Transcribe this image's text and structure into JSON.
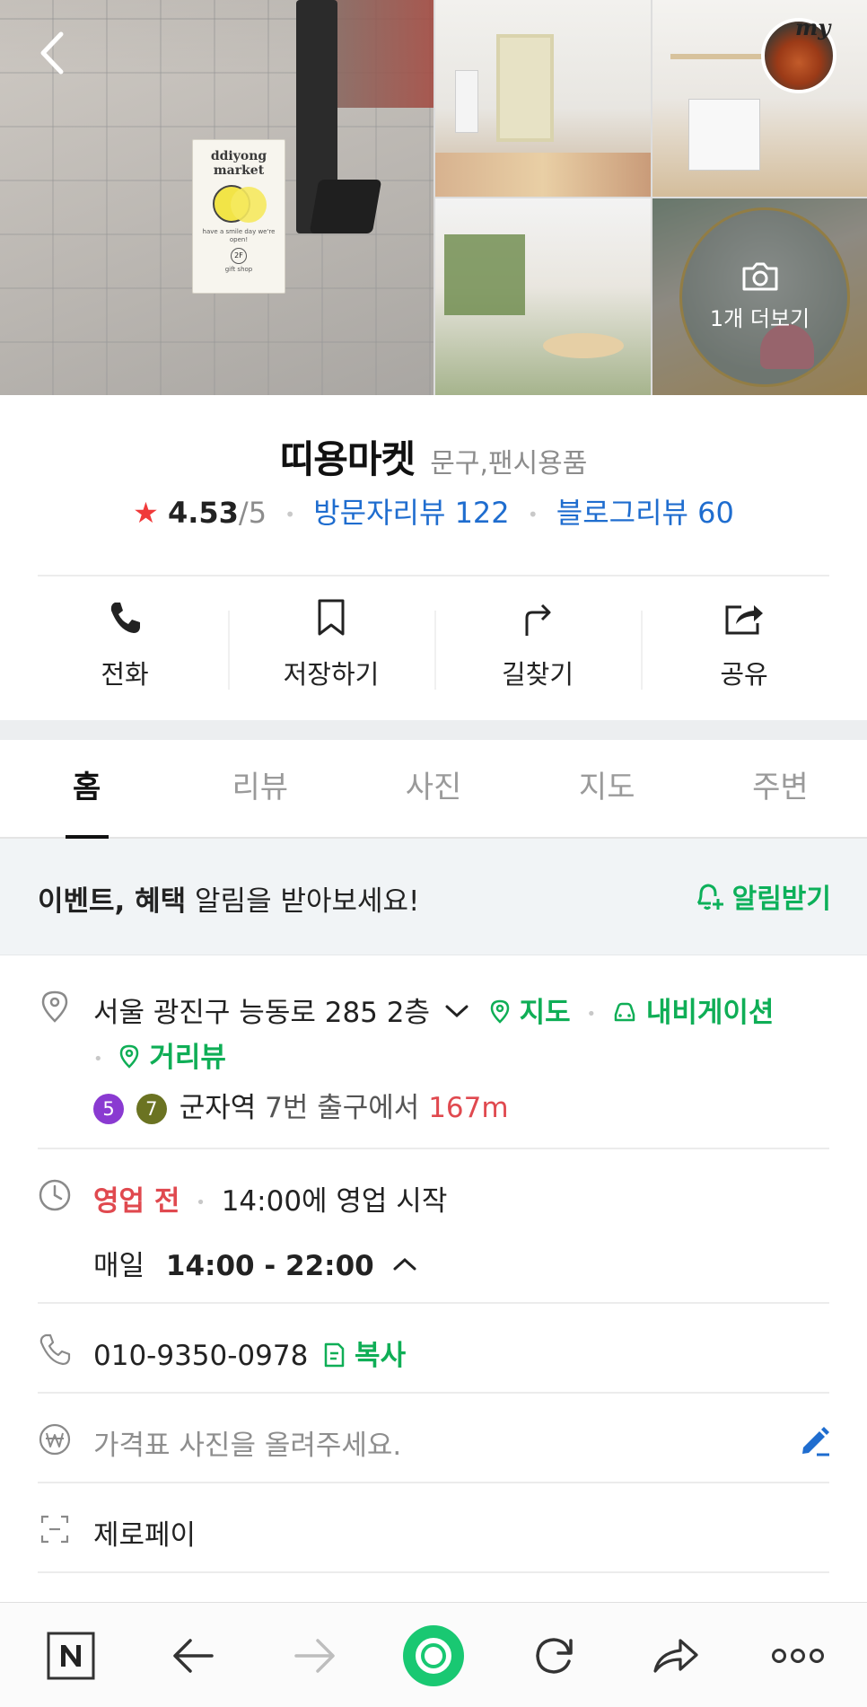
{
  "photos": {
    "sign_title": "ddiyong market",
    "sign_sub": "have a smile day we're open!",
    "sign_floor": "2F",
    "sign_footer": "gift shop",
    "more_label": "1개 더보기",
    "avatar_label": "my"
  },
  "place": {
    "name": "띠용마켓",
    "category": "문구,팬시용품",
    "rating": "4.53",
    "rating_max": "/5",
    "visitor_reviews": "방문자리뷰 122",
    "blog_reviews": "블로그리뷰 60"
  },
  "actions": [
    {
      "label": "전화",
      "icon": "phone-icon"
    },
    {
      "label": "저장하기",
      "icon": "bookmark-icon"
    },
    {
      "label": "길찾기",
      "icon": "directions-icon"
    },
    {
      "label": "공유",
      "icon": "share-icon"
    }
  ],
  "tabs": [
    "홈",
    "리뷰",
    "사진",
    "지도",
    "주변"
  ],
  "notice": {
    "bold": "이벤트, 혜택",
    "text": " 알림을 받아보세요!",
    "button": "알림받기"
  },
  "address": {
    "text": "서울 광진구 능동로 285 2층",
    "map_link": "지도",
    "nav_link": "내비게이션",
    "street_link": "거리뷰",
    "line1": "5",
    "line2": "7",
    "station": "군자역",
    "exit": "7번 출구에서",
    "distance": "167m",
    "line1_color": "#8a3ad1",
    "line2_color": "#6b7322"
  },
  "hours": {
    "status": "영업 전",
    "next": "14:00에 영업 시작",
    "day": "매일",
    "time": "14:00 - 22:00"
  },
  "phone": {
    "number": "010-9350-0978",
    "copy": "복사"
  },
  "price": {
    "placeholder": "가격표 사진을 올려주세요."
  },
  "pay": {
    "label": "제로페이"
  },
  "colors": {
    "green": "#0fae56",
    "blue": "#1f6dcf",
    "red": "#e0494f",
    "star": "#f03a3a"
  }
}
